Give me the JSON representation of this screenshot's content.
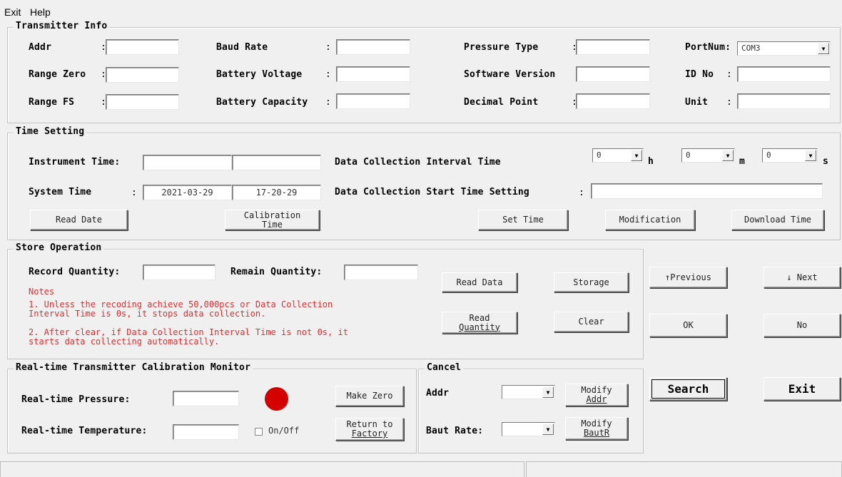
{
  "menu": {
    "exit": "Exit",
    "help": "Help"
  },
  "transmitter_info": {
    "title": "Transmitter Info",
    "addr_label": "Addr",
    "baud_label": "Baud Rate",
    "pressure_type_label": "Pressure Type",
    "portnum_label": "PortNum:",
    "portnum_value": "COM3",
    "range_zero_label": "Range Zero",
    "battery_voltage_label": "Battery Voltage",
    "software_version_label": "Software Version",
    "id_no_label": "ID No",
    "range_fs_label": "Range FS",
    "battery_capacity_label": "Battery Capacity",
    "decimal_point_label": "Decimal Point",
    "unit_label": "Unit",
    "colon": ":"
  },
  "time_setting": {
    "title": "Time Setting",
    "instrument_time_label": "Instrument Time:",
    "system_time_label": "System Time",
    "system_date": "2021-03-29",
    "system_clock": "17-20-29",
    "interval_label": "Data Collection Interval Time",
    "start_label": "Data Collection Start Time Setting",
    "h_value": "0",
    "m_value": "0",
    "s_value": "0",
    "h_unit": "h",
    "m_unit": "m",
    "s_unit": "s",
    "read_date": "Read Date",
    "calibration_time_1": "Calibration",
    "calibration_time_2": "Time",
    "set_time": "Set Time",
    "modification": "Modification",
    "download_time": "Download Time"
  },
  "store": {
    "title": "Store Operation",
    "record_quantity_label": "Record Quantity:",
    "remain_quantity_label": "Remain Quantity:",
    "notes_title": "Notes",
    "note1_a": "1. Unless the recoding achieve 50,000pcs or Data Collection",
    "note1_b": "Interval Time is 0s, it stops data collection.",
    "note2_a": "2. After clear, if Data Collection Interval Time is not 0s, it",
    "note2_b": "starts data collecting automatically.",
    "read_data": "Read Data",
    "storage": "Storage",
    "read_quantity_1": "Read",
    "read_quantity_2": "Quantity",
    "clear": "Clear"
  },
  "nav": {
    "previous": "↑Previous",
    "next": "↓ Next",
    "ok": "OK",
    "no": "No",
    "search": "Search",
    "exit": "Exit"
  },
  "calib": {
    "title": "Real-time Transmitter Calibration Monitor",
    "pressure_label": "Real-time Pressure:",
    "temperature_label": "Real-time Temperature:",
    "make_zero": "Make Zero",
    "return_1": "Return to",
    "return_2": "Factory",
    "on_off": "On/Off",
    "indicator_color": "#d40000"
  },
  "cancel": {
    "title": "Cancel",
    "addr_label": "Addr",
    "baut_label": "Baut Rate:",
    "modify_addr_1": "Modify",
    "modify_addr_2": "Addr",
    "modify_baut_1": "Modify",
    "modify_baut_2": "BautR"
  }
}
